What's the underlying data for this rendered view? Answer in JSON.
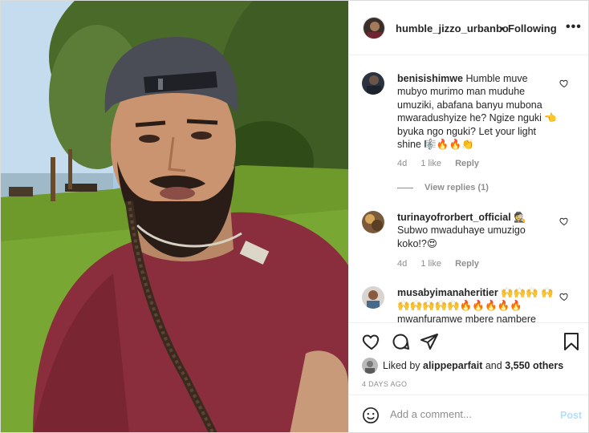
{
  "post": {
    "username": "humble_jizzo_urbanbo",
    "separator": "•",
    "follow_status": "Following",
    "more_label": "•••"
  },
  "comments": [
    {
      "username": "benisishimwe",
      "text": "Humble muve mubyo murimo man muduhe umuziki, abafana banyu mubona mwaradushyize he? Ngize nguki 👈 byuka ngo nguki? Let your light shine 🎼🔥🔥👏",
      "age": "4d",
      "likes": "1 like",
      "reply_label": "Reply",
      "view_replies": "View replies (1)"
    },
    {
      "username": "turinayofrorbert_official",
      "text": "🕵 Subwo mwaduhaye umuzigo koko!?😍",
      "age": "4d",
      "likes": "1 like",
      "reply_label": "Reply"
    },
    {
      "username": "musabyimanaheritier",
      "text": "🙌🙌🙌 🙌🙌🙌🙌🙌🙌🔥🔥🔥🔥🔥 mwanfuramwe mbere nambere",
      "age": "",
      "likes": "",
      "reply_label": ""
    }
  ],
  "likes": {
    "prefix": "Liked by",
    "user": "alippeparfait",
    "conj": "and",
    "others": "3,550 others"
  },
  "time_ago": "4 DAYS AGO",
  "add_comment": {
    "placeholder": "Add a comment...",
    "post_label": "Post"
  },
  "icons": {
    "like": "heart-icon",
    "comment": "comment-icon",
    "share": "share-icon",
    "save": "bookmark-icon",
    "more": "more-icon",
    "emoji": "emoji-icon"
  },
  "colors": {
    "text": "#262626",
    "muted": "#8e8e8e",
    "post_disabled": "#b2dffc",
    "border": "#dbdbdb"
  }
}
